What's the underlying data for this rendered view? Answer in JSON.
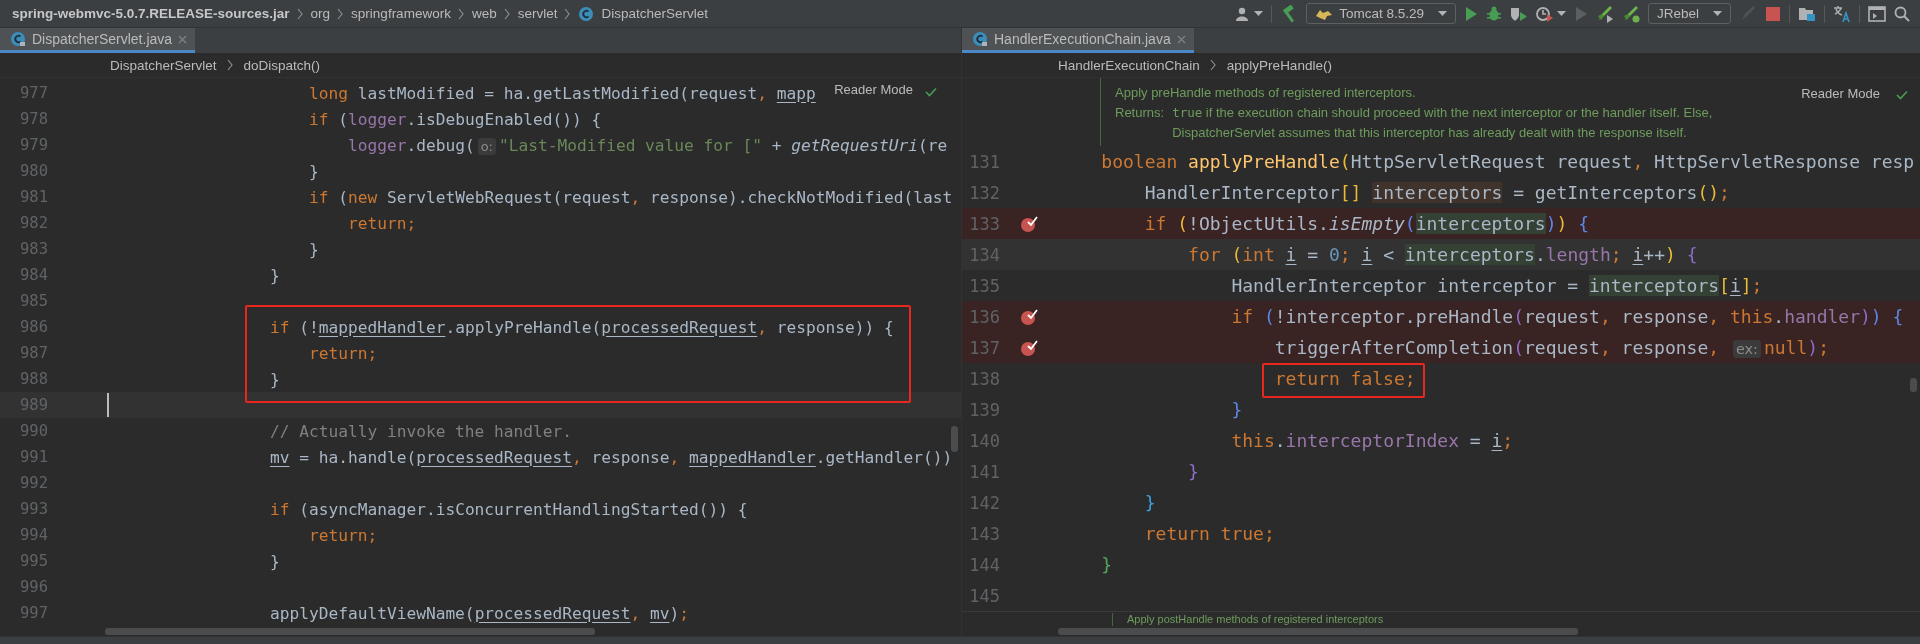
{
  "navbar": {
    "path": [
      {
        "text": "spring-webmvc-5.0.7.RELEASE-sources.jar",
        "kind": "jar"
      },
      {
        "text": "org",
        "kind": "package"
      },
      {
        "text": "springframework",
        "kind": "package"
      },
      {
        "text": "web",
        "kind": "package"
      },
      {
        "text": "servlet",
        "kind": "package"
      },
      {
        "text": "DispatcherServlet",
        "kind": "class"
      }
    ],
    "run_config": "Tomcat 8.5.29",
    "jrebel_config": "JRebel"
  },
  "panes": [
    {
      "tab": {
        "label": "DispatcherServlet.java",
        "selected": true
      },
      "breadcrumb": [
        "DispatcherServlet",
        "doDispatch()"
      ],
      "reader_mode": "Reader Mode",
      "lines": [
        {
          "number": "977",
          "current": false,
          "breakpoint": false,
          "boxed": false,
          "tokens": [
            {
              "text": "                long",
              "kind": "kw"
            },
            {
              "text": " lastModified = ha.getLastModified(request",
              "kind": "plain"
            },
            {
              "text": ", ",
              "kind": "kw"
            },
            {
              "text": "mapp",
              "kind": "ul"
            }
          ]
        },
        {
          "number": "978",
          "current": false,
          "breakpoint": false,
          "boxed": false,
          "tokens": [
            {
              "text": "                if",
              "kind": "kw"
            },
            {
              "text": " (",
              "kind": "plain"
            },
            {
              "text": "logger",
              "kind": "field"
            },
            {
              "text": ".isDebugEnabled()) {",
              "kind": "plain"
            }
          ]
        },
        {
          "number": "979",
          "current": false,
          "breakpoint": false,
          "boxed": false,
          "tokens": [
            {
              "text": "                    logger",
              "kind": "field"
            },
            {
              "text": ".debug(",
              "kind": "plain"
            },
            {
              "text": "o:",
              "kind": "hint"
            },
            {
              "text": "\"Last-Modified value for [\"",
              "kind": "str"
            },
            {
              "text": " + ",
              "kind": "plain"
            },
            {
              "text": "getRequestUri",
              "kind": "italic"
            },
            {
              "text": "(re",
              "kind": "plain"
            }
          ]
        },
        {
          "number": "980",
          "current": false,
          "breakpoint": false,
          "boxed": false,
          "tokens": [
            {
              "text": "                }",
              "kind": "plain"
            }
          ]
        },
        {
          "number": "981",
          "current": false,
          "breakpoint": false,
          "boxed": false,
          "tokens": [
            {
              "text": "                if",
              "kind": "kw"
            },
            {
              "text": " (",
              "kind": "plain"
            },
            {
              "text": "new",
              "kind": "kw"
            },
            {
              "text": " ServletWebRequest(request",
              "kind": "plain"
            },
            {
              "text": ",",
              "kind": "kw"
            },
            {
              "text": " response).checkNotModified(last",
              "kind": "plain"
            }
          ]
        },
        {
          "number": "982",
          "current": false,
          "breakpoint": false,
          "boxed": false,
          "tokens": [
            {
              "text": "                    return;",
              "kind": "kw"
            }
          ]
        },
        {
          "number": "983",
          "current": false,
          "breakpoint": false,
          "boxed": false,
          "tokens": [
            {
              "text": "                }",
              "kind": "plain"
            }
          ]
        },
        {
          "number": "984",
          "current": false,
          "breakpoint": false,
          "boxed": false,
          "tokens": [
            {
              "text": "            }",
              "kind": "plain"
            }
          ]
        },
        {
          "number": "985",
          "current": false,
          "breakpoint": false,
          "boxed": false
        },
        {
          "number": "986",
          "current": false,
          "breakpoint": false,
          "boxed": true,
          "tokens": [
            {
              "text": "            if",
              "kind": "kw"
            },
            {
              "text": " (!",
              "kind": "plain"
            },
            {
              "text": "mappedHandler",
              "kind": "ul"
            },
            {
              "text": ".applyPreHandle(",
              "kind": "plain"
            },
            {
              "text": "processedRequest",
              "kind": "ul"
            },
            {
              "text": ",",
              "kind": "kw"
            },
            {
              "text": " response)) {",
              "kind": "plain"
            }
          ]
        },
        {
          "number": "987",
          "current": false,
          "breakpoint": false,
          "boxed": true,
          "tokens": [
            {
              "text": "                return;",
              "kind": "kw"
            }
          ]
        },
        {
          "number": "988",
          "current": false,
          "breakpoint": false,
          "boxed": true,
          "tokens": [
            {
              "text": "            }",
              "kind": "plain"
            }
          ]
        },
        {
          "number": "989",
          "current": true,
          "breakpoint": false,
          "boxed": false
        },
        {
          "number": "990",
          "current": false,
          "breakpoint": false,
          "boxed": false,
          "tokens": [
            {
              "text": "            // Actually invoke the handler.",
              "kind": "comment"
            }
          ]
        },
        {
          "number": "991",
          "current": false,
          "breakpoint": false,
          "boxed": false,
          "tokens": [
            {
              "text": "            mv",
              "kind": "ul"
            },
            {
              "text": " = ha.handle(",
              "kind": "plain"
            },
            {
              "text": "processedRequest",
              "kind": "ul"
            },
            {
              "text": ",",
              "kind": "kw"
            },
            {
              "text": " response",
              "kind": "plain"
            },
            {
              "text": ", ",
              "kind": "kw"
            },
            {
              "text": "mappedHandler",
              "kind": "ul"
            },
            {
              "text": ".getHandler())",
              "kind": "plain"
            }
          ]
        },
        {
          "number": "992",
          "current": false,
          "breakpoint": false,
          "boxed": false
        },
        {
          "number": "993",
          "current": false,
          "breakpoint": false,
          "boxed": false,
          "tokens": [
            {
              "text": "            if",
              "kind": "kw"
            },
            {
              "text": " (asyncManager.isConcurrentHandlingStarted()) {",
              "kind": "plain"
            }
          ]
        },
        {
          "number": "994",
          "current": false,
          "breakpoint": false,
          "boxed": false,
          "tokens": [
            {
              "text": "                return;",
              "kind": "kw"
            }
          ]
        },
        {
          "number": "995",
          "current": false,
          "breakpoint": false,
          "boxed": false,
          "tokens": [
            {
              "text": "            }",
              "kind": "plain"
            }
          ]
        },
        {
          "number": "996",
          "current": false,
          "breakpoint": false,
          "boxed": false
        },
        {
          "number": "997",
          "current": false,
          "breakpoint": false,
          "boxed": false,
          "tokens": [
            {
              "text": "            applyDefaultViewName(",
              "kind": "plain"
            },
            {
              "text": "processedRequest",
              "kind": "ul"
            },
            {
              "text": ", ",
              "kind": "kw"
            },
            {
              "text": "mv",
              "kind": "ul"
            },
            {
              "text": ")",
              "kind": "plain"
            },
            {
              "text": ";",
              "kind": "kw"
            }
          ]
        }
      ]
    },
    {
      "tab": {
        "label": "HandlerExecutionChain.java",
        "selected": true
      },
      "breadcrumb": [
        "HandlerExecutionChain",
        "applyPreHandle()"
      ],
      "reader_mode": "Reader Mode",
      "doc": {
        "summary": "Apply preHandle methods of registered interceptors.",
        "returns_label": "Returns:",
        "returns_code": "true",
        "returns_text": [
          " if the execution chain should proceed with the next interceptor or the handler itself. Else,",
          "DispatcherServlet assumes that this interceptor has already dealt with the response itself."
        ]
      },
      "lines": [
        {
          "number": "131",
          "current": false,
          "breakpoint": false,
          "boxed": false,
          "tokens": [
            {
              "text": "    boolean ",
              "kind": "kw"
            },
            {
              "text": "applyPreHandle",
              "kind": "method"
            },
            {
              "text": "(",
              "kind": "br1"
            },
            {
              "text": "HttpServletRequest request",
              "kind": "plain"
            },
            {
              "text": ",",
              "kind": "kw"
            },
            {
              "text": " HttpServletResponse resp",
              "kind": "plain"
            }
          ]
        },
        {
          "number": "132",
          "current": false,
          "breakpoint": false,
          "boxed": false,
          "tokens": [
            {
              "text": "        HandlerInterceptor",
              "kind": "plain"
            },
            {
              "text": "[] ",
              "kind": "br1"
            },
            {
              "text": "interceptors",
              "kind": "write"
            },
            {
              "text": " = getInterceptors",
              "kind": "plain"
            },
            {
              "text": "()",
              "kind": "br1"
            },
            {
              "text": ";",
              "kind": "kw"
            }
          ]
        },
        {
          "number": "133",
          "current": false,
          "breakpoint": true,
          "boxed": false,
          "tokens": [
            {
              "text": "        if ",
              "kind": "kw"
            },
            {
              "text": "(",
              "kind": "br1"
            },
            {
              "text": "!ObjectUtils.",
              "kind": "plain"
            },
            {
              "text": "isEmpty",
              "kind": "italic"
            },
            {
              "text": "(",
              "kind": "br2"
            },
            {
              "text": "interceptors",
              "kind": "read"
            },
            {
              "text": ")",
              "kind": "br2"
            },
            {
              "text": ") ",
              "kind": "br1"
            },
            {
              "text": "{",
              "kind": "br2"
            }
          ]
        },
        {
          "number": "134",
          "current": true,
          "breakpoint": false,
          "boxed": false,
          "tokens": [
            {
              "text": "            for ",
              "kind": "kw"
            },
            {
              "text": "(",
              "kind": "br1"
            },
            {
              "text": "int ",
              "kind": "kw"
            },
            {
              "text": "i",
              "kind": "ul"
            },
            {
              "text": " = ",
              "kind": "plain"
            },
            {
              "text": "0",
              "kind": "num"
            },
            {
              "text": "; ",
              "kind": "kw"
            },
            {
              "text": "i",
              "kind": "ul"
            },
            {
              "text": " < ",
              "kind": "plain"
            },
            {
              "text": "interceptors",
              "kind": "read"
            },
            {
              "text": ".",
              "kind": "plain"
            },
            {
              "text": "length",
              "kind": "field"
            },
            {
              "text": "; ",
              "kind": "kw"
            },
            {
              "text": "i",
              "kind": "ul"
            },
            {
              "text": "++",
              "kind": "plain"
            },
            {
              "text": ") ",
              "kind": "br1"
            },
            {
              "text": "{",
              "kind": "br3"
            }
          ]
        },
        {
          "number": "135",
          "current": false,
          "breakpoint": false,
          "boxed": false,
          "tokens": [
            {
              "text": "                HandlerInterceptor interceptor = ",
              "kind": "plain"
            },
            {
              "text": "interceptors",
              "kind": "read"
            },
            {
              "text": "[",
              "kind": "br1"
            },
            {
              "text": "i",
              "kind": "ul"
            },
            {
              "text": "]",
              "kind": "br1"
            },
            {
              "text": ";",
              "kind": "kw"
            }
          ]
        },
        {
          "number": "136",
          "current": false,
          "breakpoint": true,
          "boxed": false,
          "tokens": [
            {
              "text": "                if ",
              "kind": "kw"
            },
            {
              "text": "(",
              "kind": "br2"
            },
            {
              "text": "!interceptor.preHandle",
              "kind": "plain"
            },
            {
              "text": "(",
              "kind": "br3"
            },
            {
              "text": "request",
              "kind": "plain"
            },
            {
              "text": ",",
              "kind": "kw"
            },
            {
              "text": " response",
              "kind": "plain"
            },
            {
              "text": ", ",
              "kind": "kw"
            },
            {
              "text": "this",
              "kind": "kw"
            },
            {
              "text": ".",
              "kind": "plain"
            },
            {
              "text": "handler",
              "kind": "field"
            },
            {
              "text": ")",
              "kind": "br3"
            },
            {
              "text": ") ",
              "kind": "br2"
            },
            {
              "text": "{",
              "kind": "br2"
            }
          ]
        },
        {
          "number": "137",
          "current": false,
          "breakpoint": true,
          "boxed": false,
          "tokens": [
            {
              "text": "                    triggerAfterCompletion",
              "kind": "plain"
            },
            {
              "text": "(",
              "kind": "br3"
            },
            {
              "text": "request",
              "kind": "plain"
            },
            {
              "text": ",",
              "kind": "kw"
            },
            {
              "text": " response",
              "kind": "plain"
            },
            {
              "text": ", ",
              "kind": "kw"
            },
            {
              "text": "ex:",
              "kind": "hint"
            },
            {
              "text": "null",
              "kind": "kw"
            },
            {
              "text": ")",
              "kind": "br3"
            },
            {
              "text": ";",
              "kind": "kw"
            }
          ]
        },
        {
          "number": "138",
          "current": false,
          "breakpoint": false,
          "boxed": true,
          "tokens": [
            {
              "text": "                    return false;",
              "kind": "kw"
            }
          ]
        },
        {
          "number": "139",
          "current": false,
          "breakpoint": false,
          "boxed": false,
          "tokens": [
            {
              "text": "                }",
              "kind": "br2"
            }
          ]
        },
        {
          "number": "140",
          "current": false,
          "breakpoint": false,
          "boxed": false,
          "tokens": [
            {
              "text": "                this",
              "kind": "kw"
            },
            {
              "text": ".",
              "kind": "plain"
            },
            {
              "text": "interceptorIndex",
              "kind": "field"
            },
            {
              "text": " = ",
              "kind": "plain"
            },
            {
              "text": "i",
              "kind": "ul"
            },
            {
              "text": ";",
              "kind": "kw"
            }
          ]
        },
        {
          "number": "141",
          "current": false,
          "breakpoint": false,
          "boxed": false,
          "tokens": [
            {
              "text": "            }",
              "kind": "br3"
            }
          ]
        },
        {
          "number": "142",
          "current": false,
          "breakpoint": false,
          "boxed": false,
          "tokens": [
            {
              "text": "        }",
              "kind": "br4"
            }
          ]
        },
        {
          "number": "143",
          "current": false,
          "breakpoint": false,
          "boxed": false,
          "tokens": [
            {
              "text": "        return true;",
              "kind": "kw"
            }
          ]
        },
        {
          "number": "144",
          "current": false,
          "breakpoint": false,
          "boxed": false,
          "tokens": [
            {
              "text": "    }",
              "kind": "brg"
            }
          ]
        },
        {
          "number": "145",
          "current": false,
          "breakpoint": false,
          "boxed": false
        }
      ],
      "next_doc": "Apply postHandle methods of registered interceptors"
    }
  ]
}
